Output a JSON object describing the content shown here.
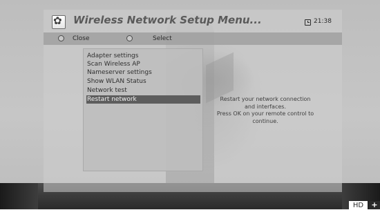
{
  "header": {
    "title": "Wireless Network Setup Menu...",
    "icon": "gear-icon",
    "time": "21:38",
    "time_icon": "clock-icon"
  },
  "buttons": {
    "close_label": "Close",
    "select_label": "Select"
  },
  "menu": {
    "items": [
      {
        "label": "Adapter settings",
        "selected": false
      },
      {
        "label": "Scan Wireless AP",
        "selected": false
      },
      {
        "label": "Nameserver settings",
        "selected": false
      },
      {
        "label": "Show WLAN Status",
        "selected": false
      },
      {
        "label": "Network test",
        "selected": false
      },
      {
        "label": "Restart network",
        "selected": true
      }
    ]
  },
  "description": {
    "lines": [
      "Restart your network connection",
      "and interfaces.",
      "Press OK on your remote control to",
      "continue."
    ]
  },
  "badges": {
    "hd": "HD",
    "plus": "+"
  },
  "colors": {
    "selection": "#5d5d5d",
    "overlay": "#cecece",
    "button_bar": "#9e9e9e"
  }
}
